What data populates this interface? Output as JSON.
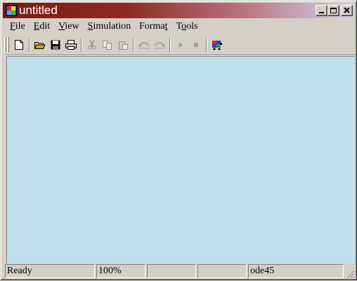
{
  "window": {
    "title": "untitled",
    "icon": "simulink-model-icon"
  },
  "menu": {
    "items": [
      {
        "label": "File",
        "mnemonic": "F",
        "rest": "ile"
      },
      {
        "label": "Edit",
        "mnemonic": "E",
        "rest": "dit"
      },
      {
        "label": "View",
        "mnemonic": "V",
        "rest": "iew"
      },
      {
        "label": "Simulation",
        "mnemonic": "S",
        "rest": "imulation"
      },
      {
        "label": "Format",
        "pre": "Forma",
        "mnemonic": "t",
        "rest": ""
      },
      {
        "label": "Tools",
        "pre": "T",
        "mnemonic": "o",
        "rest": "ols"
      }
    ]
  },
  "toolbar": {
    "buttons": [
      "new-icon",
      "open-icon",
      "save-icon",
      "print-icon",
      "cut-icon",
      "copy-icon",
      "paste-icon",
      "undo-icon",
      "redo-icon",
      "start-simulation-icon",
      "stop-simulation-icon",
      "library-browser-icon"
    ]
  },
  "canvas": {
    "background": "#bee0ee"
  },
  "statusbar": {
    "status": "Ready",
    "zoom": "100%",
    "pane3": "",
    "pane4": "",
    "solver": "ode45"
  }
}
